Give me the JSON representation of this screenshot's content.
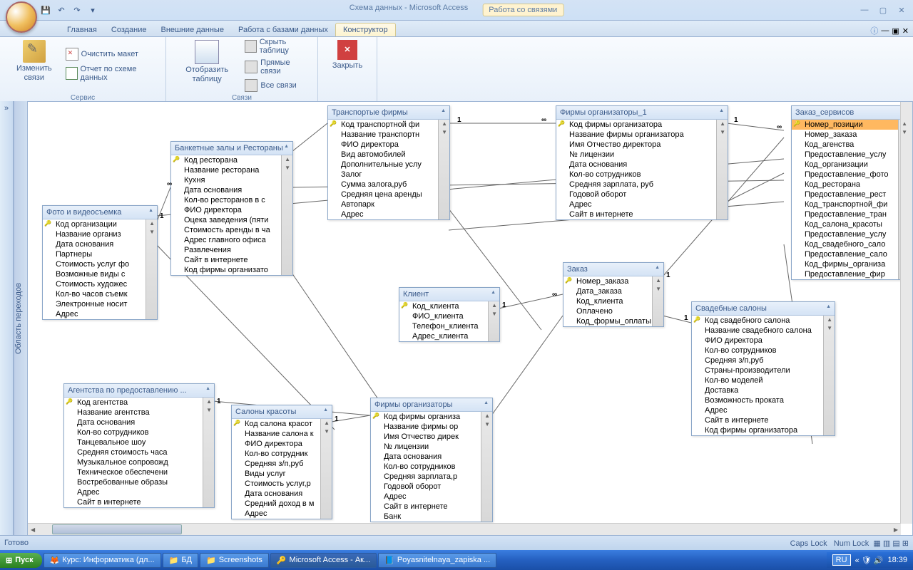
{
  "window": {
    "title1": "Схема данных - Microsoft Access",
    "title2": "Работа со связями"
  },
  "tabs": {
    "home": "Главная",
    "create": "Создание",
    "external": "Внешние данные",
    "dbtools": "Работа с базами данных",
    "design": "Конструктор"
  },
  "ribbon": {
    "edit_rel": "Изменить связи",
    "clear_layout": "Очистить макет",
    "rel_report": "Отчет по схеме данных",
    "group1": "Сервис",
    "show_table": "Отобразить таблицу",
    "hide_table": "Скрыть таблицу",
    "direct_rel": "Прямые связи",
    "all_rel": "Все связи",
    "group2": "Связи",
    "close": "Закрыть"
  },
  "side_panel": "Область переходов",
  "status": {
    "left": "Готово",
    "caps": "Caps Lock",
    "num": "Num Lock"
  },
  "taskbar": {
    "start": "Пуск",
    "t1": "Курс: Информатика (дл...",
    "t2": "БД",
    "t3": "Screenshots",
    "t4": "Microsoft Access - Ак...",
    "t5": "Poyasnitelnaya_zapiska ...",
    "lang": "RU",
    "time": "18:39"
  },
  "tables": {
    "photo": {
      "title": "Фото и видеосъемка",
      "fields": [
        "Код организации",
        "Название организ",
        "Дата основания",
        "Партнеры",
        "Стоимость услуг фо",
        "Возможные виды с",
        "Стоимость художес",
        "Кол-во часов съемк",
        "Электронные носит",
        "Адрес"
      ]
    },
    "banquet": {
      "title": "Банкетные залы и Рестораны",
      "fields": [
        "Код ресторана",
        "Название ресторана",
        "Кухня",
        "Дата основания",
        "Кол-во ресторанов в с",
        "ФИО директора",
        "Оцека заведения (пяти",
        "Стоимость аренды в ча",
        "Адрес главного офиса",
        "Развлечения",
        "Сайт в интернете",
        "Код фирмы организато"
      ]
    },
    "transport": {
      "title": "Транспортые фирмы",
      "fields": [
        "Код транспортной фи",
        "Название транспортн",
        "ФИО директора",
        "Вид автомобилей",
        "Дополнительные услу",
        "Залог",
        "Сумма залога,руб",
        "Средняя цена аренды",
        "Автопарк",
        "Адрес"
      ]
    },
    "firms1": {
      "title": "Фирмы организаторы_1",
      "fields": [
        "Код фирмы организатора",
        "Название фирмы организатора",
        "Имя Отчество директора",
        "№ лицензии",
        "Дата основания",
        "Кол-во сотрудников",
        "Средняя зарплата, руб",
        "Годовой оборот",
        "Адрес",
        "Сайт в интернете"
      ]
    },
    "zakaz_serv": {
      "title": "Заказ_сервисов",
      "selected": "Номер_позиции",
      "fields": [
        "Номер_заказа",
        "Код_агенства",
        "Предоставление_услу",
        "Код_организации",
        "Предоставление_фото",
        "Код_ресторана",
        "Предоставление_рест",
        "Код_транспортной_фи",
        "Предоставление_тран",
        "Код_салона_красоты",
        "Предоставление_услу",
        "Код_свадебного_сало",
        "Предоставление_сало",
        "Код_фирмы_организа",
        "Предоставление_фир"
      ]
    },
    "agency": {
      "title": "Агентства по предоставлению ...",
      "fields": [
        "Код агентства",
        "Название агентства",
        "Дата основания",
        "Кол-во сотрудников",
        "Танцевальное шоу",
        "Средняя стоимость часа",
        "Музыкальное сопровожд",
        "Техническое обеспечени",
        "Востребованные образы",
        "Адрес",
        "Сайт в интернете"
      ]
    },
    "salon": {
      "title": "Салоны красоты",
      "fields": [
        "Код салона красот",
        "Название салона к",
        "ФИО директора",
        "Кол-во сотрудник",
        "Средняя з/п,руб",
        "Виды услуг",
        "Стоимость услуг,р",
        "Дата основания",
        "Средний доход в м",
        "Адрес"
      ]
    },
    "client": {
      "title": "Клиент",
      "fields": [
        "Код_клиента",
        "ФИО_клиента",
        "Телефон_клиента",
        "Адрес_клиента"
      ]
    },
    "zakaz": {
      "title": "Заказ",
      "fields": [
        "Номер_заказа",
        "Дата_заказа",
        "Код_клиента",
        "Оплачено",
        "Код_формы_оплаты"
      ]
    },
    "firms": {
      "title": "Фирмы организаторы",
      "fields": [
        "Код фирмы организа",
        "Название фирмы ор",
        "Имя Отчество дирек",
        "№ лицензии",
        "Дата основания",
        "Кол-во сотрудников",
        "Средняя зарплата,р",
        "Годовой оборот",
        "Адрес",
        "Сайт в интернете",
        "Банк"
      ]
    },
    "wedding": {
      "title": "Свадебные салоны",
      "fields": [
        "Код свадебного салона",
        "Название свадебного салона",
        "ФИО директора",
        "Кол-во сотрудников",
        "Средняя з/п,руб",
        "Страны-производители",
        "Кол-во моделей",
        "Доставка",
        "Возможность проката",
        "Адрес",
        "Сайт в интернете",
        "Код фирмы организатора"
      ]
    }
  }
}
